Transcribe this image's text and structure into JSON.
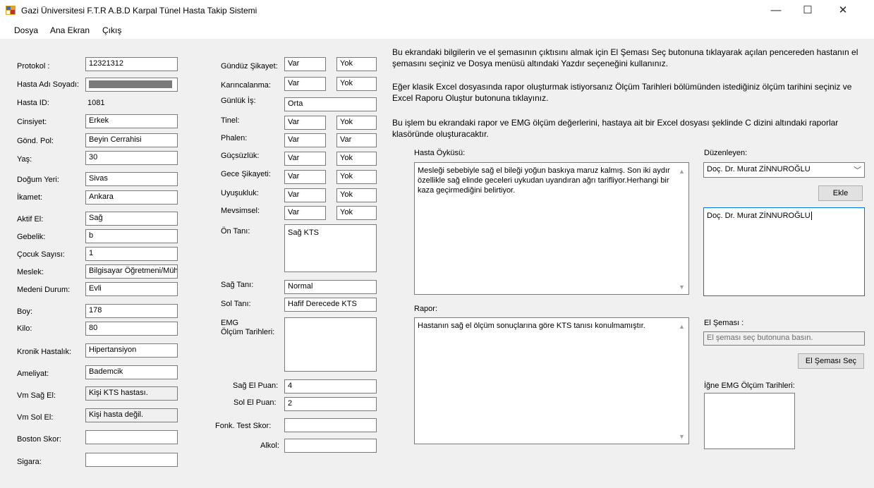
{
  "window": {
    "title": "Gazi Üniversitesi F.T.R A.B.D Karpal Tünel Hasta Takip Sistemi",
    "minimize": "—",
    "maximize": "☐",
    "close": "✕"
  },
  "menu": {
    "file": "Dosya",
    "main_screen": "Ana Ekran",
    "exit": "Çıkış"
  },
  "patient": {
    "protocol_label": "Protokol :",
    "protocol_value": "12321312",
    "name_label": "Hasta Adı Soyadı:",
    "id_label": "Hasta ID:",
    "id_value": "1081",
    "gender_label": "Cinsiyet:",
    "gender_value": "Erkek",
    "sent_pol_label": "Gönd. Pol:",
    "sent_pol_value": "Beyin Cerrahisi",
    "age_label": "Yaş:",
    "age_value": "30",
    "birthplace_label": "Doğum Yeri:",
    "birthplace_value": "Sivas",
    "residence_label": "İkamet:",
    "residence_value": "Ankara",
    "active_hand_label": "Aktif El:",
    "active_hand_value": "Sağ",
    "pregnancy_label": "Gebelik:",
    "pregnancy_value": "b",
    "children_label": "Çocuk Sayısı:",
    "children_value": "1",
    "job_label": "Meslek:",
    "job_value": "Bilgisayar Öğretmeni/Mühe",
    "marital_label": "Medeni Durum:",
    "marital_value": "Evli",
    "height_label": "Boy:",
    "height_value": "178",
    "weight_label": "Kilo:",
    "weight_value": "80",
    "chronic_label": "Kronik Hastalık:",
    "chronic_value": "Hipertansiyon",
    "surgery_label": "Ameliyat:",
    "surgery_value": "Bademcik",
    "vm_right_label": "Vm Sağ El:",
    "vm_right_value": "Kişi KTS hastası.",
    "vm_left_label": "Vm Sol El:",
    "vm_left_value": "Kişi hasta değil.",
    "boston_label": "Boston Skor:",
    "boston_value": "",
    "smoking_label": "Sigara:",
    "smoking_value": ""
  },
  "complaints": {
    "day_label": "Gündüz Şikayet:",
    "day_a": "Var",
    "day_b": "Yok",
    "tingling_label": "Karıncalanma:",
    "tingling_a": "Var",
    "tingling_b": "Yok",
    "daily_work_label": "Günlük İş:",
    "daily_work_value": "Orta",
    "tinel_label": "Tinel:",
    "tinel_a": "Var",
    "tinel_b": "Yok",
    "phalen_label": "Phalen:",
    "phalen_a": "Var",
    "phalen_b": "Var",
    "weakness_label": "Güçsüzlük:",
    "weakness_a": "Var",
    "weakness_b": "Yok",
    "night_label": "Gece Şikayeti:",
    "night_a": "Var",
    "night_b": "Yok",
    "numbness_label": "Uyuşukluk:",
    "numbness_a": "Var",
    "numbness_b": "Yok",
    "seasonal_label": "Mevsimsel:",
    "seasonal_a": "Var",
    "seasonal_b": "Yok",
    "pre_diag_label": "Ön Tanı:",
    "pre_diag_value": "Sağ KTS",
    "right_diag_label": "Sağ Tanı:",
    "right_diag_value": "Normal",
    "left_diag_label": "Sol Tanı:",
    "left_diag_value": "Hafif Derecede KTS",
    "emg_label_1": "EMG",
    "emg_label_2": "Ölçüm Tarihleri:",
    "right_score_label": "Sağ El Puan:",
    "right_score_value": "4",
    "left_score_label": "Sol El Puan:",
    "left_score_value": "2",
    "func_test_label": "Fonk. Test Skor:",
    "func_test_value": "",
    "alcohol_label": "Alkol:",
    "alcohol_value": ""
  },
  "info": {
    "p1": "Bu ekrandaki bilgilerin ve el şemasının çıktısını almak için El Şeması Seç butonuna tıklayarak açılan pencereden hastanın el şemasını seçiniz ve Dosya menüsü altındaki Yazdır seçeneğini kullanınız.",
    "p2": "Eğer klasik Excel dosyasında rapor oluşturmak istiyorsanız Ölçüm Tarihleri bölümünden istediğiniz ölçüm tarihini seçiniz ve Excel Raporu Oluştur butonuna tıklayınız.",
    "p3": "Bu işlem bu ekrandaki rapor ve EMG ölçüm değerlerini, hastaya ait bir Excel dosyası şeklinde C dizini altındaki raporlar klasöründe oluşturacaktır."
  },
  "history": {
    "label": "Hasta Öyküsü:",
    "text": "Mesleği sebebiyle sağ el bileği yoğun baskıya maruz kalmış. Son iki aydır özellikle sağ elinde geceleri uykudan uyandıran ağrı tarifliyor.Herhangi bir kaza geçirmediğini belirtiyor."
  },
  "report": {
    "label": "Rapor:",
    "text": "Hastanın sağ el ölçüm sonuçlarına göre KTS tanısı konulmamıştır."
  },
  "editor": {
    "label": "Düzenleyen:",
    "selected": "Doç. Dr. Murat ZİNNUROĞLU",
    "add_button": "Ekle",
    "list_text": "Doç. Dr. Murat ZİNNUROĞLU"
  },
  "hand_schema": {
    "label": "El Şeması :",
    "placeholder": "El şeması seç butonuna basın.",
    "button": "El Şeması Seç"
  },
  "needle_emg": {
    "label": "İğne EMG Ölçüm Tarihleri:"
  },
  "colors": {
    "window_bg": "#f0f0f0",
    "focus_border": "#0078d7",
    "border": "#7a7a7a"
  }
}
